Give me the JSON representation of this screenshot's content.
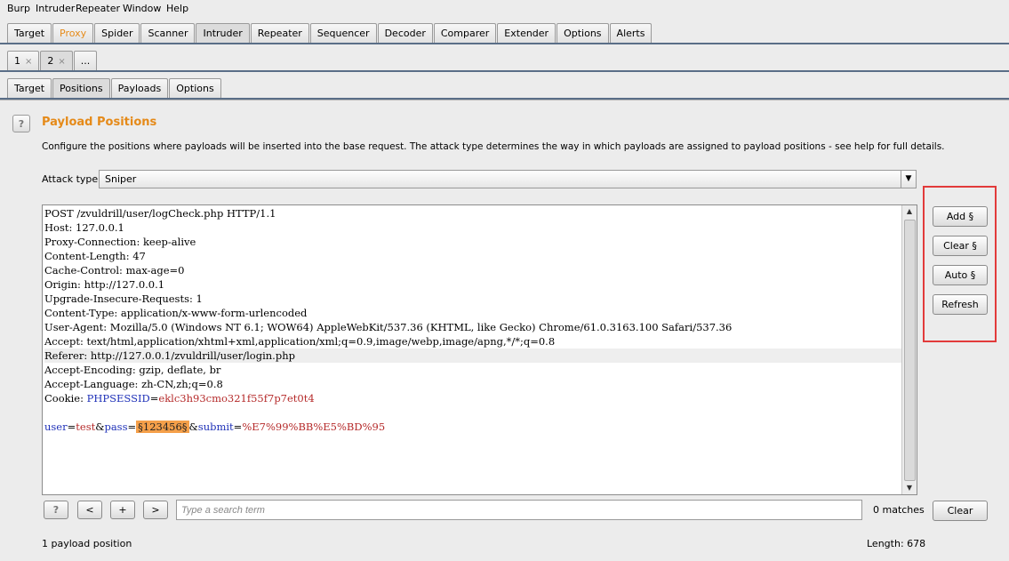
{
  "menu": [
    "Burp",
    "Intruder",
    "Repeater",
    "Window",
    "Help"
  ],
  "main_tabs": [
    {
      "label": "Target"
    },
    {
      "label": "Proxy"
    },
    {
      "label": "Spider"
    },
    {
      "label": "Scanner"
    },
    {
      "label": "Intruder"
    },
    {
      "label": "Repeater"
    },
    {
      "label": "Sequencer"
    },
    {
      "label": "Decoder"
    },
    {
      "label": "Comparer"
    },
    {
      "label": "Extender"
    },
    {
      "label": "Options"
    },
    {
      "label": "Alerts"
    }
  ],
  "attack_tabs": [
    {
      "label": "1",
      "close": "×"
    },
    {
      "label": "2",
      "close": "×"
    },
    {
      "label": "...",
      "close": ""
    }
  ],
  "sub_tabs": [
    {
      "label": "Target"
    },
    {
      "label": "Positions"
    },
    {
      "label": "Payloads"
    },
    {
      "label": "Options"
    }
  ],
  "panel": {
    "help": "?",
    "title": "Payload Positions",
    "description": "Configure the positions where payloads will be inserted into the base request. The attack type determines the way in which payloads are assigned to payload positions - see help for full details.",
    "attack_type_label": "Attack type:",
    "attack_type_value": "Sniper"
  },
  "request": {
    "lines": [
      "POST /zvuldrill/user/logCheck.php HTTP/1.1",
      "Host: 127.0.0.1",
      "Proxy-Connection: keep-alive",
      "Content-Length: 47",
      "Cache-Control: max-age=0",
      "Origin: http://127.0.0.1",
      "Upgrade-Insecure-Requests: 1",
      "Content-Type: application/x-www-form-urlencoded",
      "User-Agent: Mozilla/5.0 (Windows NT 6.1; WOW64) AppleWebKit/537.36 (KHTML, like Gecko) Chrome/61.0.3163.100 Safari/537.36",
      "Accept: text/html,application/xhtml+xml,application/xml;q=0.9,image/webp,image/apng,*/*;q=0.8",
      "Referer: http://127.0.0.1/zvuldrill/user/login.php",
      "Accept-Encoding: gzip, deflate, br",
      "Accept-Language: zh-CN,zh;q=0.8"
    ],
    "cookie_prefix": "Cookie: ",
    "cookie_name": "PHPSESSID",
    "cookie_eq": "=",
    "cookie_value": "eklc3h93cmo321f55f7p7et0t4",
    "body": {
      "p1_name": "user",
      "eq1": "=",
      "p1_val": "test",
      "amp1": "&",
      "p2_name": "pass",
      "eq2": "=",
      "p2_marked": "§123456§",
      "amp2": "&",
      "p3_name": "submit",
      "eq3": "=",
      "p3_val": "%E7%99%BB%E5%BD%95"
    }
  },
  "side_buttons": {
    "add": "Add §",
    "clear": "Clear §",
    "auto": "Auto §",
    "refresh": "Refresh"
  },
  "search": {
    "help": "?",
    "prev": "<",
    "plus": "+",
    "next": ">",
    "placeholder": "Type a search term",
    "matches": "0 matches",
    "clear": "Clear"
  },
  "status": {
    "positions": "1 payload position",
    "length": "Length: 678"
  }
}
